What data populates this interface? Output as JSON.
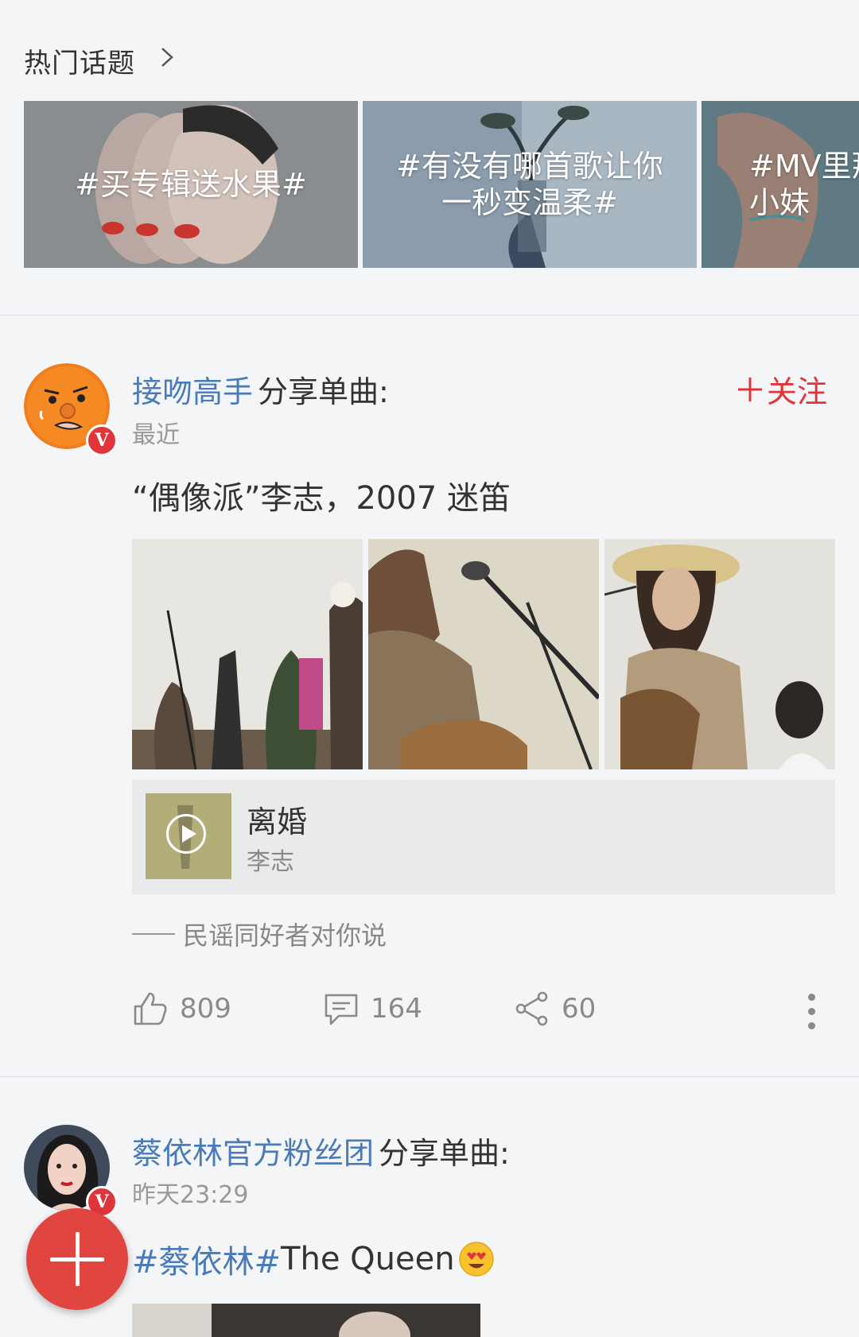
{
  "topics_section": {
    "title": "热门话题",
    "cards": [
      {
        "text": "#买专辑送水果#"
      },
      {
        "text": "#有没有哪首歌让你\n一秒变温柔#"
      },
      {
        "text": "#MV里那\n小妹"
      }
    ]
  },
  "posts": [
    {
      "username": "接吻高手",
      "action": "分享单曲:",
      "time": "最近",
      "follow_label": "关注",
      "text": "“偶像派”李志，2007 迷笛",
      "music": {
        "title": "离婚",
        "artist": "李志"
      },
      "source": "民谣同好者对你说",
      "likes": "809",
      "comments": "164",
      "shares": "60"
    },
    {
      "username": "蔡依林官方粉丝团",
      "action": "分享单曲:",
      "time": "昨天23:29",
      "hashtag": "#蔡依林#",
      "text": " The Queen"
    }
  ],
  "colors": {
    "accent_red": "#e0363a",
    "link_blue": "#4a7bb8",
    "background": "#f4f5f7"
  },
  "badge_letter": "V"
}
